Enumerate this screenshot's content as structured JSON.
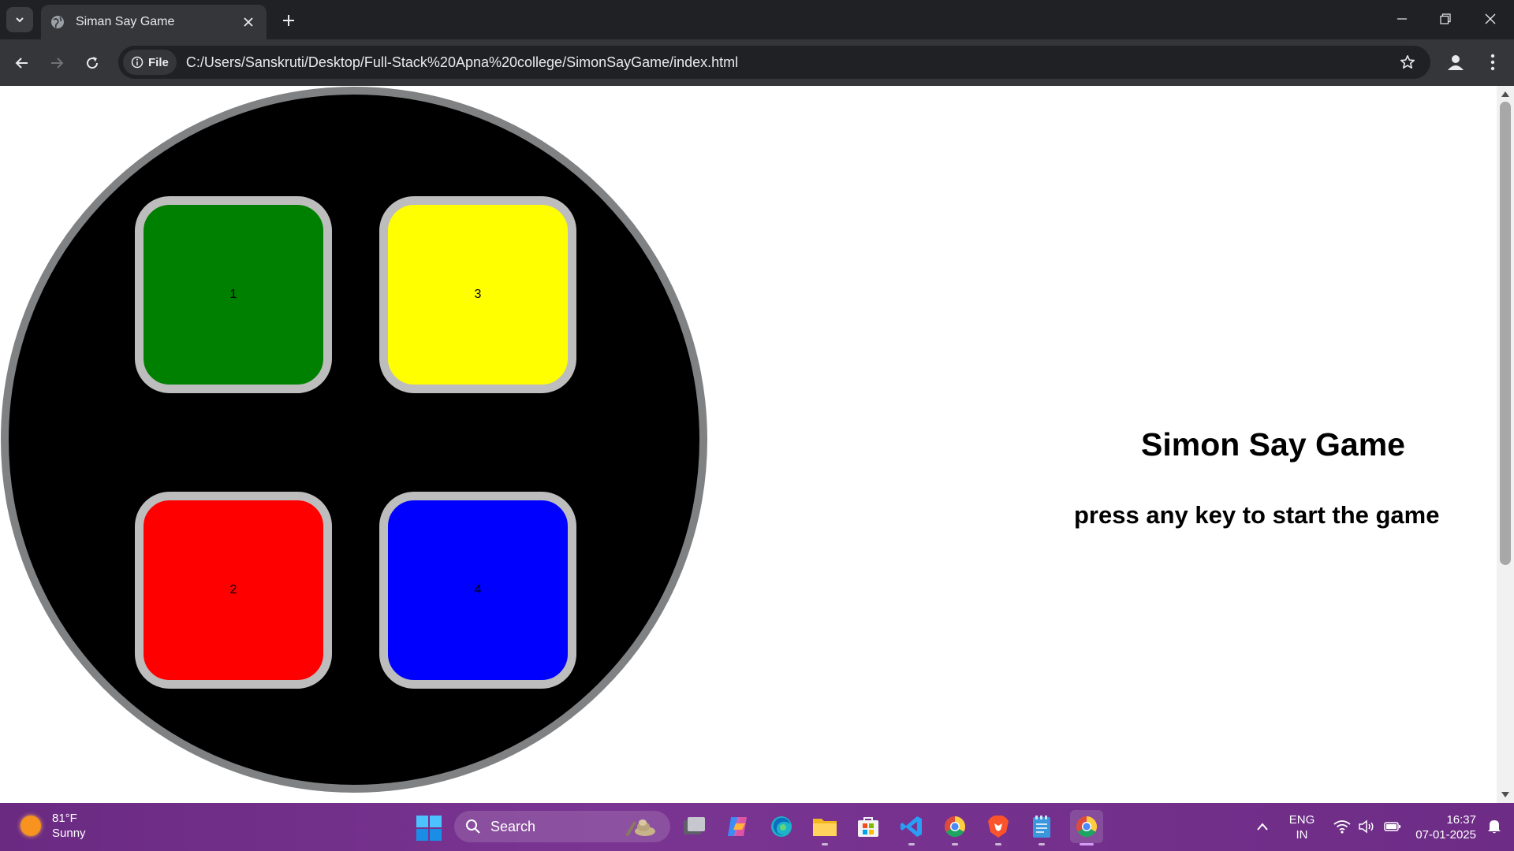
{
  "browser": {
    "tab_title": "Siman Say Game",
    "url": "C:/Users/Sanskruti/Desktop/Full-Stack%20Apna%20college/SimonSayGame/index.html",
    "site_chip_label": "File"
  },
  "game": {
    "title": "Simon Say Game",
    "subtitle": "press any key to start the game",
    "pads": [
      {
        "label": "1",
        "color": "#008000"
      },
      {
        "label": "3",
        "color": "#ffff00"
      },
      {
        "label": "2",
        "color": "#ff0000"
      },
      {
        "label": "4",
        "color": "#0000ff"
      }
    ]
  },
  "taskbar": {
    "weather_temp": "81°F",
    "weather_desc": "Sunny",
    "search_placeholder": "Search",
    "language_line1": "ENG",
    "language_line2": "IN",
    "time": "16:37",
    "date": "07-01-2025"
  }
}
